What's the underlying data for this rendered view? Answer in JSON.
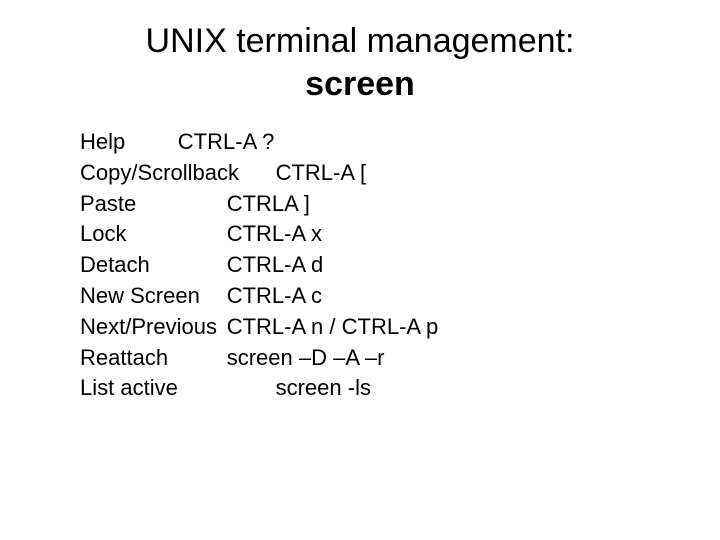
{
  "title": {
    "line1": "UNIX terminal management:",
    "line2": "screen"
  },
  "items": [
    {
      "label": "Help",
      "key": "CTRL-A ?",
      "tabs": "\t\t"
    },
    {
      "label": "Copy/Scrollback",
      "key": "CTRL-A [",
      "tabs": "\t"
    },
    {
      "label": "Paste",
      "key": "CTRLA ]",
      "tabs": "\t\t"
    },
    {
      "label": "Lock",
      "key": "CTRL-A x",
      "tabs": "\t\t"
    },
    {
      "label": "Detach",
      "key": "CTRL-A d",
      "tabs": "\t\t"
    },
    {
      "label": "New Screen",
      "key": "CTRL-A c",
      "tabs": "\t"
    },
    {
      "label": "Next/Previous",
      "key": "CTRL-A n / CTRL-A p",
      "tabs": "\t"
    },
    {
      "label": "Reattach",
      "key": "screen –D –A –r",
      "tabs": "\t\t"
    },
    {
      "label": "List active",
      "key": "screen -ls",
      "tabs": "\t\t"
    }
  ]
}
